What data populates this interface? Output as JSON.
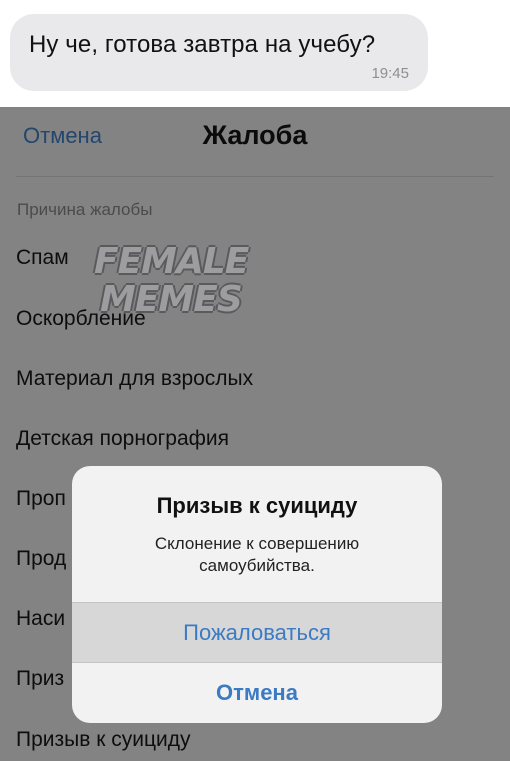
{
  "chat": {
    "message_text": "Ну че, готова завтра на учебу?",
    "time": "19:45"
  },
  "sheet": {
    "cancel_label": "Отмена",
    "title": "Жалоба",
    "section_header": "Причина жалобы",
    "reasons": [
      "Спам",
      "Оскорбление",
      "Материал для взрослых",
      "Детская порнография",
      "Проп",
      "Прод",
      "Наси",
      "Приз",
      "Призыв к суициду"
    ]
  },
  "watermark": {
    "line1": "FEMALE",
    "line2": "MEMES"
  },
  "alert": {
    "title": "Призыв к суициду",
    "message": "Склонение к совершению самоубийства.",
    "confirm_label": "Пожаловаться",
    "cancel_label": "Отмена"
  },
  "colors": {
    "link_blue": "#3b7bc4",
    "dimmed_background": "#838384",
    "bubble_gray": "#e9e9eb"
  }
}
